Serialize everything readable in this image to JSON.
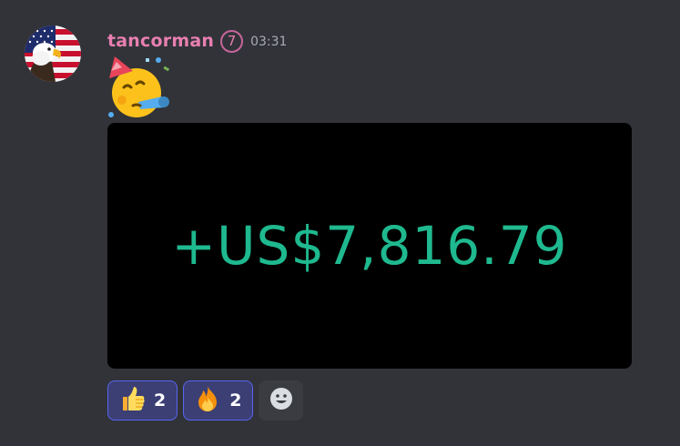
{
  "message": {
    "author": "tancorman",
    "badge": "7",
    "timestamp": "03:31",
    "emoji": "partying-face",
    "image": {
      "amount_text": "+US$7,816.79",
      "amount_color": "#1fb98f",
      "background": "#000000"
    },
    "reactions": [
      {
        "emoji": "thumbs-up",
        "count": "2"
      },
      {
        "emoji": "fire",
        "count": "2"
      }
    ],
    "add_reaction_icon": "smiley-add-icon"
  },
  "colors": {
    "background": "#313338",
    "username": "#e87fb0",
    "timestamp": "#a8abb3",
    "reaction_active_bg": "#3b3f74",
    "reaction_active_border": "#5865f2"
  }
}
